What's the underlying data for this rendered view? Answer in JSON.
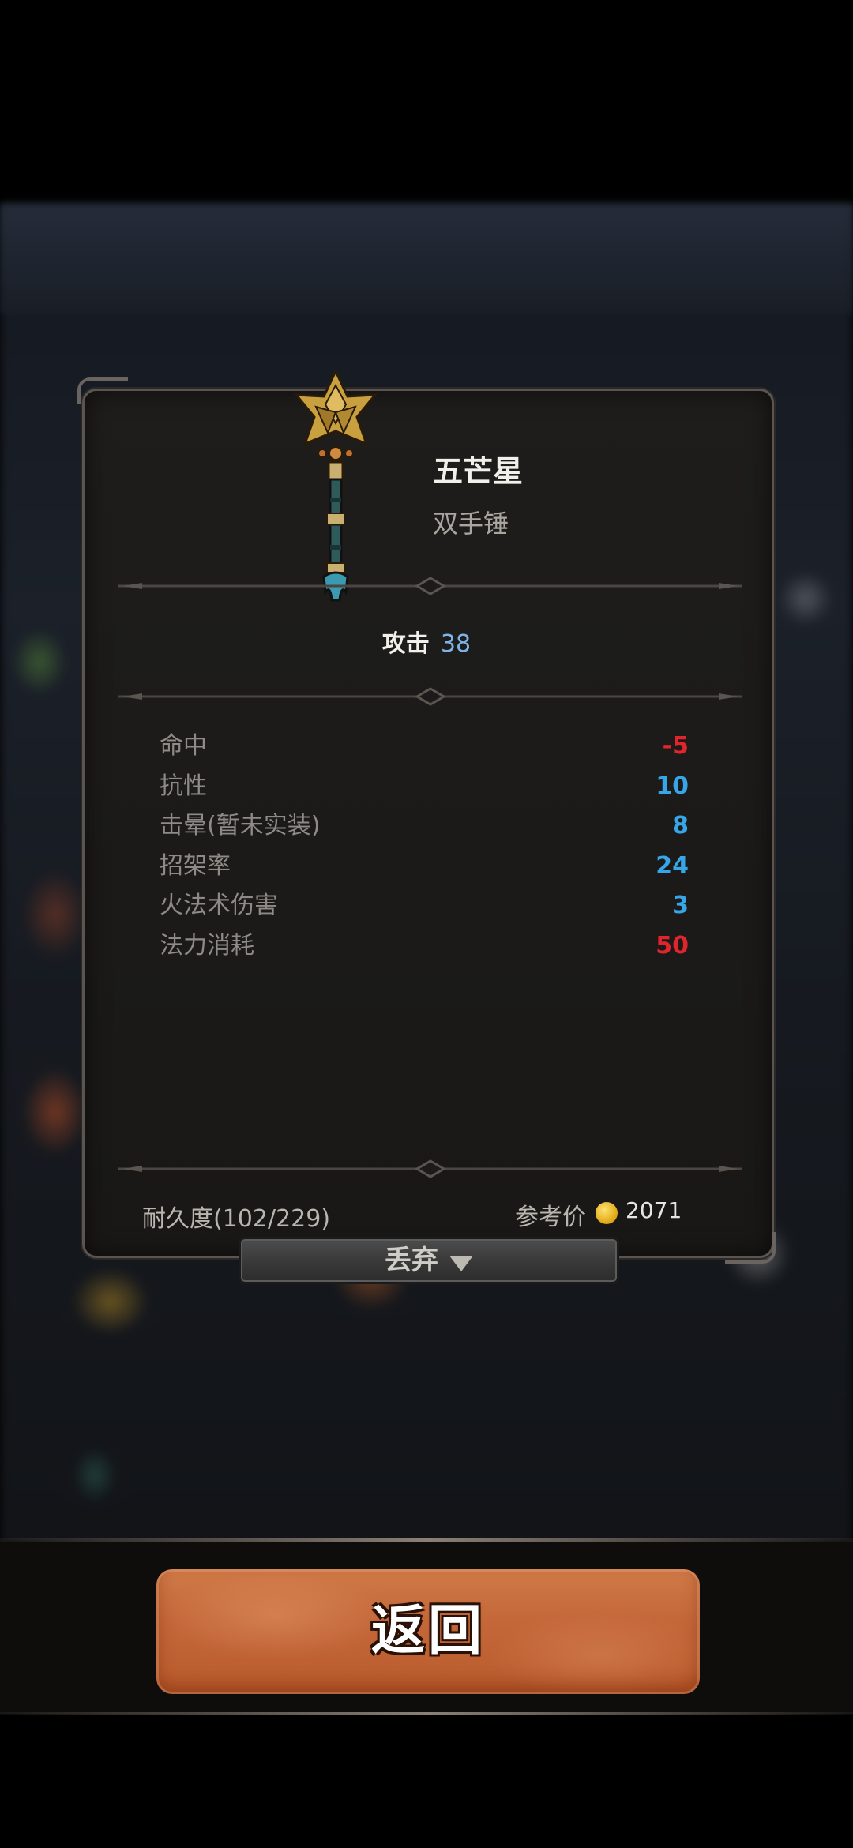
{
  "item": {
    "name": "五芒星",
    "type": "双手锤",
    "icon": "star-mace-icon"
  },
  "attack": {
    "label": "攻击",
    "value": "38"
  },
  "stats": [
    {
      "label": "命中",
      "value": "-5",
      "color": "#e0262c"
    },
    {
      "label": "抗性",
      "value": "10",
      "color": "#37a6e8"
    },
    {
      "label": "击晕(暂未实装)",
      "value": "8",
      "color": "#37a6e8"
    },
    {
      "label": "招架率",
      "value": "24",
      "color": "#37a6e8"
    },
    {
      "label": "火法术伤害",
      "value": "3",
      "color": "#37a6e8"
    },
    {
      "label": "法力消耗",
      "value": "50",
      "color": "#e0262c"
    }
  ],
  "durability": "耐久度(102/229)",
  "price": {
    "label": "参考价",
    "value": "2071",
    "icon": "gold-coin-icon"
  },
  "discard_button": {
    "label": "丢弃",
    "icon": "chevron-down-icon"
  },
  "back_button": {
    "label": "返回"
  },
  "colors": {
    "accent": "#c4683a",
    "positive": "#37a6e8",
    "negative": "#e0262c",
    "attack": "#7fb2e6"
  }
}
